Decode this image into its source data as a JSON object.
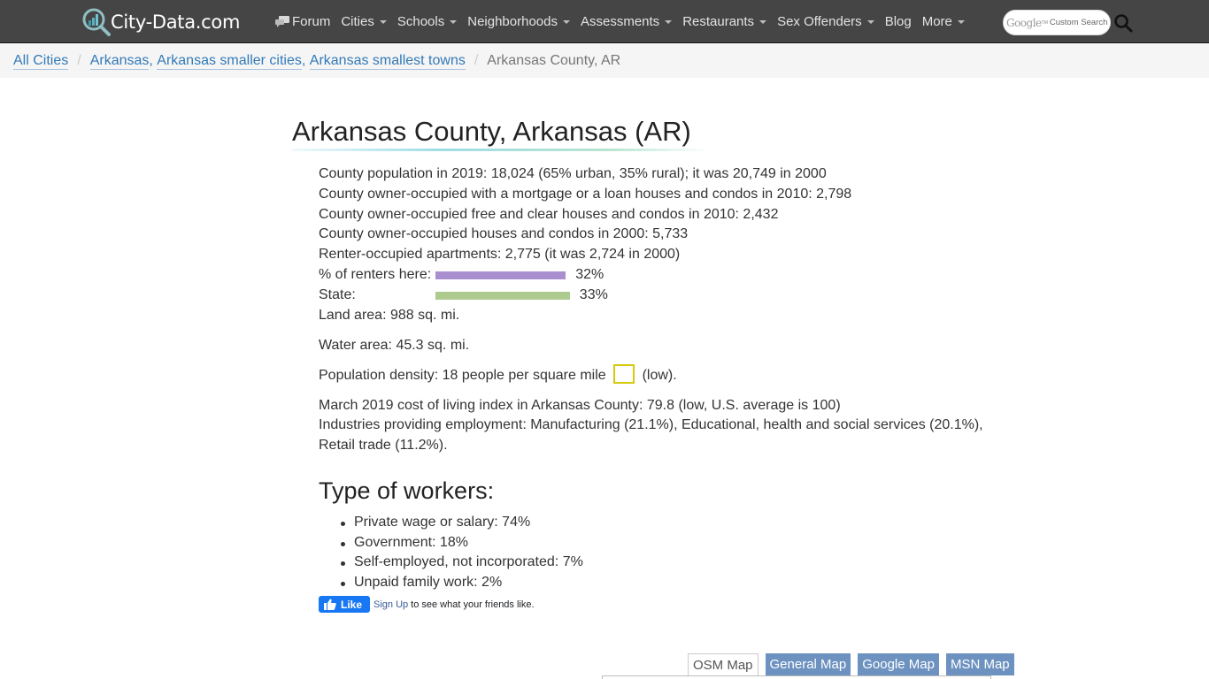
{
  "site": {
    "logo_text": "City-Data.com"
  },
  "nav": {
    "items": [
      {
        "label": "Forum",
        "has_caret": false,
        "icon": "forum-chat-icon"
      },
      {
        "label": "Cities",
        "has_caret": true
      },
      {
        "label": "Schools",
        "has_caret": true
      },
      {
        "label": "Neighborhoods",
        "has_caret": true
      },
      {
        "label": "Assessments",
        "has_caret": true
      },
      {
        "label": "Restaurants",
        "has_caret": true
      },
      {
        "label": "Sex Offenders",
        "has_caret": true
      },
      {
        "label": "Blog",
        "has_caret": false
      },
      {
        "label": "More",
        "has_caret": true
      }
    ],
    "search": {
      "google_word": "Google",
      "tm": "TM",
      "placeholder": "Custom Search",
      "button_icon": "search-icon"
    }
  },
  "breadcrumb": {
    "root": "All Cities",
    "state_links": [
      "Arkansas",
      "Arkansas smaller cities",
      "Arkansas smallest towns"
    ],
    "current": "Arkansas County, AR"
  },
  "page": {
    "title": "Arkansas County, Arkansas (AR)",
    "lines": {
      "population": "County population in 2019: 18,024 (65% urban, 35% rural); it was 20,749 in 2000",
      "mortgage": "County owner-occupied with a mortgage or a loan houses and condos in 2010: 2,798",
      "free_clear": "County owner-occupied free and clear houses and condos in 2010: 2,432",
      "owner_2000": "County owner-occupied houses and condos in 2000: 5,733",
      "renter": "Renter-occupied apartments: 2,775 (it was 2,724 in 2000)"
    },
    "renters_bars": [
      {
        "label": "% of renters here:",
        "value_text": "32%",
        "percent": 32,
        "color": "#a98fd0"
      },
      {
        "label": "State:",
        "value_text": "33%",
        "percent": 33,
        "color": "#aecb8f"
      }
    ],
    "land_area": "Land area: 988 sq. mi.",
    "water_area": "Water area: 45.3 sq. mi.",
    "density": {
      "text": "Population density: 18 people per square mile",
      "level": "(low).",
      "box_color": "#d6c90e"
    },
    "cost_of_living": "March 2019 cost of living index in Arkansas County: 79.8 (low, U.S. average is 100)",
    "industries_1": "Industries providing employment: Manufacturing (21.1%), Educational, health and social services (20.1%),",
    "industries_2": "Retail trade (11.2%).",
    "workers": {
      "title": "Type of workers:",
      "items": [
        "Private wage or salary: 74%",
        "Government: 18%",
        "Self-employed, not incorporated: 7%",
        "Unpaid family work: 2%"
      ]
    },
    "facebook": {
      "like_label": "Like",
      "signup_label": "Sign Up",
      "text": "to see what your friends like."
    },
    "map_tabs": [
      {
        "label": "OSM Map",
        "active": true
      },
      {
        "label": "General Map",
        "active": false
      },
      {
        "label": "Google Map",
        "active": false
      },
      {
        "label": "MSN Map",
        "active": false
      }
    ]
  }
}
